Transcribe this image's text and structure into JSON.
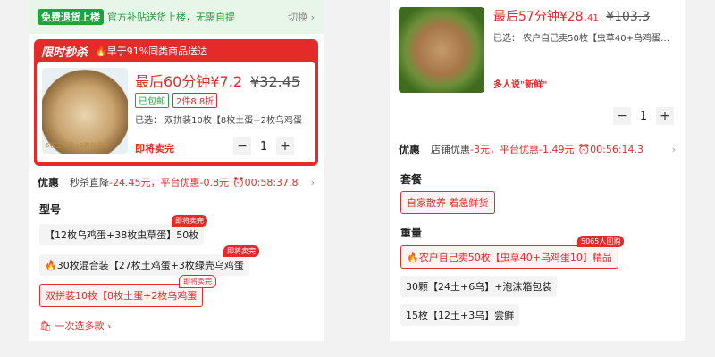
{
  "colors": {
    "accent_red": "#e52a2a",
    "accent_green": "#1fa33b"
  },
  "left": {
    "banner": {
      "tag": "免费退货上楼",
      "text": "官方补贴送货上楼，无需自提",
      "switch": "切换 ›"
    },
    "flash": {
      "label": "限时秒杀",
      "note": "早于91%同类商品送达",
      "thumb_caption": "6枚虫草蛋+2枚乌鸡蛋",
      "price_prefix": "最后60分钟",
      "price": "¥7.2",
      "old_price": "¥32.45",
      "badge_free": "已包邮",
      "badge_discount": "2件8.8折",
      "selected": "已选：  双拼装10枚【8枚土蛋+2枚乌鸡蛋",
      "selling_out": "即将卖完",
      "qty": "1"
    },
    "deal": {
      "title": "优惠",
      "direct": "秒杀直降",
      "direct_amt": "-24.45元，",
      "platform": "平台优惠-0.8元",
      "timer": "⏰00:58:37.8",
      "chev": "›"
    },
    "model": {
      "title": "型号",
      "options": [
        {
          "label": "【12枚乌鸡蛋+38枚虫草蛋】50枚",
          "tag": "即将卖完"
        },
        {
          "label": "🔥30枚混合装【27枚土鸡蛋+3枚绿壳乌鸡蛋",
          "tag": "即将卖完"
        },
        {
          "label": "双拼装10枚【8枚土蛋+2枚乌鸡蛋",
          "tag": "即将卖完"
        }
      ]
    },
    "more": "🛍 一次选多款 ›"
  },
  "right": {
    "product": {
      "price_prefix": "最后57分钟",
      "price": "¥28.",
      "price_dec": "41",
      "old_price": "¥103.3",
      "selected": "已选：  农户自己卖50枚【虫草40+乌鸡蛋…",
      "many_say": "多人说\"新鲜\"",
      "qty": "1"
    },
    "deal": {
      "title": "优惠",
      "shop": "店铺优惠",
      "shop_amt": "-3元，",
      "platform": "平台优惠-1.49元",
      "timer": "⏰00:56:14.3",
      "chev": "›"
    },
    "set": {
      "title": "套餐",
      "option": "自家散养 着急鲜货"
    },
    "weight": {
      "title": "重量",
      "options": [
        {
          "label": "🔥农户自己卖50枚【虫草40+乌鸡蛋10】精品",
          "tag": "5065人回购"
        },
        {
          "label": "30颗【24土+6乌】+泡沫箱包装"
        },
        {
          "label": "15枚【12土+3乌】尝鲜"
        }
      ]
    }
  }
}
